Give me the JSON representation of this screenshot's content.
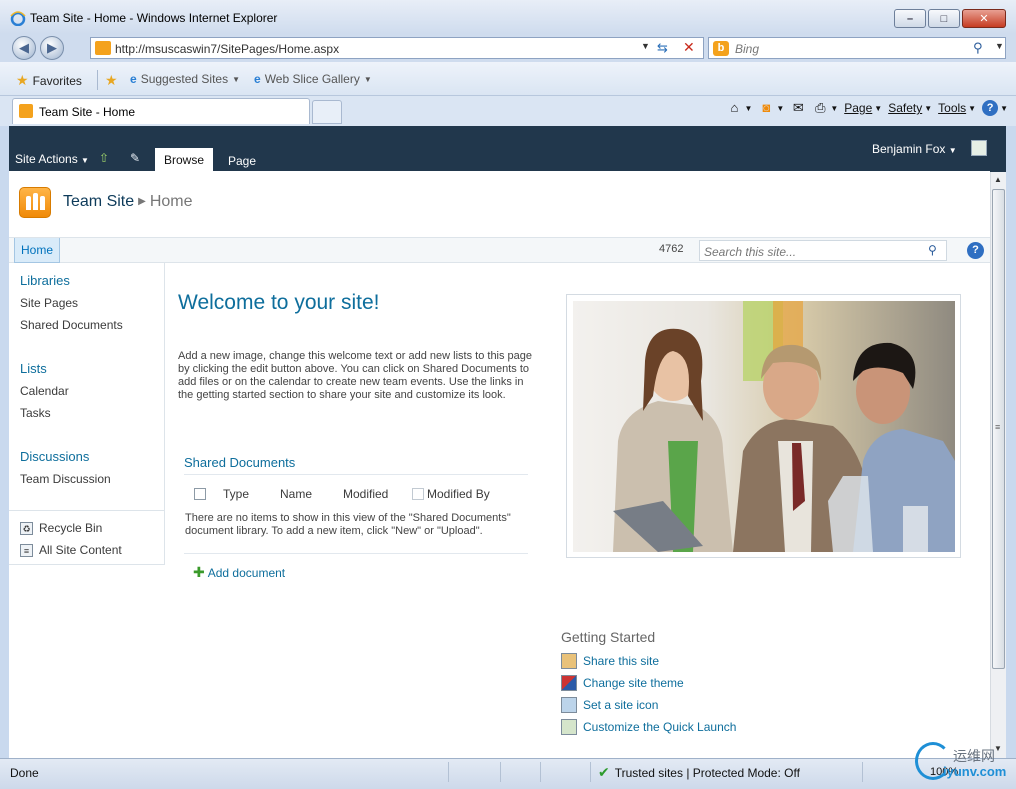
{
  "window": {
    "title": "Team Site - Home - Windows Internet Explorer",
    "address": "http://msuscaswin7/SitePages/Home.aspx",
    "search_placeholder": "Bing",
    "favorites_label": "Favorites",
    "suggested_sites": "Suggested Sites",
    "web_slice_gallery": "Web Slice Gallery",
    "tab_label": "Team Site - Home",
    "commands": {
      "page": "Page",
      "safety": "Safety",
      "tools": "Tools"
    }
  },
  "ribbon": {
    "site_actions": "Site Actions",
    "tab_browse": "Browse",
    "tab_page": "Page",
    "user": "Benjamin Fox"
  },
  "breadcrumb": {
    "site": "Team Site",
    "current": "Home"
  },
  "topnav": {
    "home": "Home",
    "count": "4762",
    "search_placeholder": "Search this site..."
  },
  "quicklaunch": {
    "sections": [
      {
        "heading": "Libraries",
        "items": [
          "Site Pages",
          "Shared Documents"
        ]
      },
      {
        "heading": "Lists",
        "items": [
          "Calendar",
          "Tasks"
        ]
      },
      {
        "heading": "Discussions",
        "items": [
          "Team Discussion"
        ]
      }
    ],
    "utilities": [
      "Recycle Bin",
      "All Site Content"
    ]
  },
  "main": {
    "welcome": "Welcome to your site!",
    "intro": "Add a new image, change this welcome text or add new lists to this page by clicking the edit button above. You can click on Shared Documents to add files or on the calendar to create new team events. Use the links in the getting started section to share your site and customize its look.",
    "docs": {
      "title": "Shared Documents",
      "columns": [
        "Type",
        "Name",
        "Modified",
        "Modified By"
      ],
      "empty": "There are no items to show in this view of the \"Shared Documents\" document library. To add a new item, click \"New\" or \"Upload\".",
      "add": "Add document"
    }
  },
  "getting_started": {
    "title": "Getting Started",
    "links": [
      "Share this site",
      "Change site theme",
      "Set a site icon",
      "Customize the Quick Launch"
    ]
  },
  "statusbar": {
    "status": "Done",
    "zone": "Trusted sites | Protected Mode: Off",
    "zoom": "100%"
  },
  "watermark": {
    "cn": "运维网",
    "en": "iyunv.com"
  }
}
